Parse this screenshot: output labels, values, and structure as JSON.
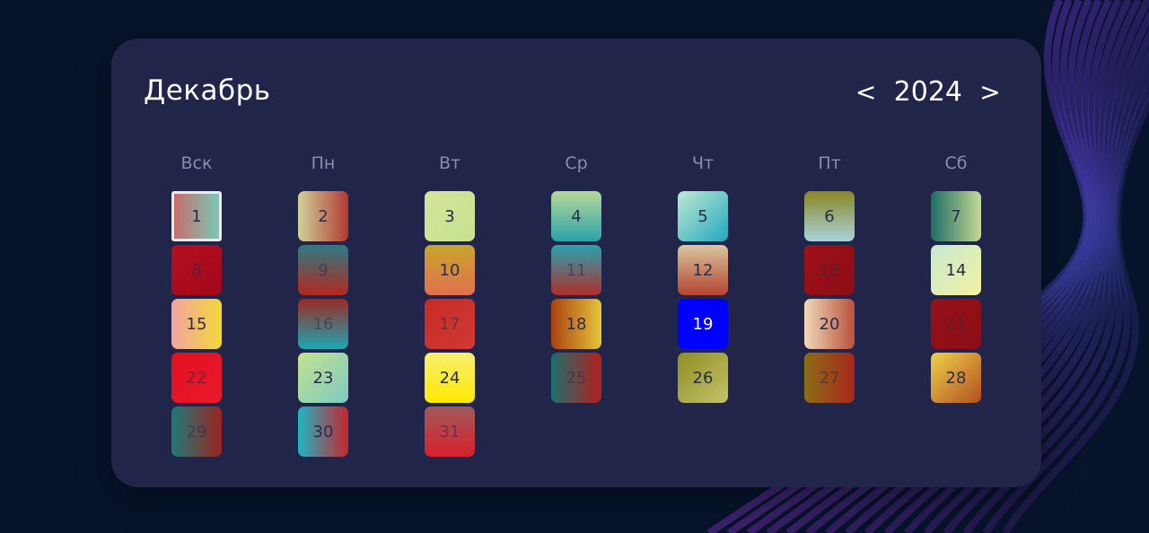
{
  "calendar": {
    "month": "Декабрь",
    "year": "2024",
    "prev_label": "<",
    "next_label": ">",
    "weekdays": [
      "Вск",
      "Пн",
      "Вт",
      "Ср",
      "Чт",
      "Пт",
      "Сб"
    ],
    "selected_day": 1,
    "days": [
      {
        "n": "1",
        "bg": "linear-gradient(90deg,#c86d6b,#7bc9b6)"
      },
      {
        "n": "2",
        "bg": "linear-gradient(90deg,#cfd19b,#b33a33)"
      },
      {
        "n": "3",
        "bg": "linear-gradient(135deg,#d3e59b,#c7e28e)"
      },
      {
        "n": "4",
        "bg": "linear-gradient(180deg,#b6d89a,#2aa3a8)"
      },
      {
        "n": "5",
        "bg": "linear-gradient(135deg,#bfe8d3,#21a9c1)"
      },
      {
        "n": "6",
        "bg": "linear-gradient(180deg,#8a8621,#a8d3dc)"
      },
      {
        "n": "7",
        "bg": "linear-gradient(90deg,#1e6d63,#c6d995)"
      },
      {
        "n": "8",
        "bg": "linear-gradient(135deg,#b5101f,#a0081a)",
        "dim": true
      },
      {
        "n": "9",
        "bg": "linear-gradient(180deg,#2c7b83,#b3281f)",
        "dim": true
      },
      {
        "n": "10",
        "bg": "linear-gradient(180deg,#c8a52b,#e2704f)"
      },
      {
        "n": "11",
        "bg": "linear-gradient(180deg,#2aa0b0,#b0302b)",
        "dim": true
      },
      {
        "n": "12",
        "bg": "linear-gradient(180deg,#d9c6a0,#b4432e)"
      },
      {
        "n": "13",
        "bg": "linear-gradient(135deg,#9e1018,#8c0d16)",
        "dim": true
      },
      {
        "n": "14",
        "bg": "linear-gradient(135deg,#c6e9cf,#f4f2a0)"
      },
      {
        "n": "15",
        "bg": "linear-gradient(90deg,#f2a4a0,#f2d83a)"
      },
      {
        "n": "16",
        "bg": "linear-gradient(180deg,#9b2a22,#1ea6b4)",
        "dim": true
      },
      {
        "n": "17",
        "bg": "linear-gradient(135deg,#c72a25,#d03b35)",
        "dim": true
      },
      {
        "n": "18",
        "bg": "linear-gradient(90deg,#a94112,#e7c43a)"
      },
      {
        "n": "19",
        "bg": "#0000ff",
        "light": true
      },
      {
        "n": "20",
        "bg": "linear-gradient(90deg,#f1d8b8,#b9513b)"
      },
      {
        "n": "21",
        "bg": "linear-gradient(135deg,#981018,#8a0d15)",
        "dim": true
      },
      {
        "n": "22",
        "bg": "linear-gradient(135deg,#e3101f,#e81a2c)",
        "dim": true
      },
      {
        "n": "23",
        "bg": "linear-gradient(135deg,#c3e38f,#7ec9c1)"
      },
      {
        "n": "24",
        "bg": "linear-gradient(180deg,#f8f070,#ffe800)"
      },
      {
        "n": "25",
        "bg": "linear-gradient(90deg,#1f6f6d,#b3201d)",
        "dim": true
      },
      {
        "n": "26",
        "bg": "linear-gradient(135deg,#8f8e23,#c2c26a)"
      },
      {
        "n": "27",
        "bg": "linear-gradient(90deg,#8b6d18,#a8261a)",
        "dim": true
      },
      {
        "n": "28",
        "bg": "linear-gradient(135deg,#f0d14a,#b24f1f)"
      },
      {
        "n": "29",
        "bg": "linear-gradient(90deg,#1f7a78,#9b241f)",
        "dim": true
      },
      {
        "n": "30",
        "bg": "linear-gradient(90deg,#1fb4c4,#c8262d)"
      },
      {
        "n": "31",
        "bg": "linear-gradient(180deg,#a05a5a,#d8202c)",
        "dim": true
      }
    ]
  }
}
